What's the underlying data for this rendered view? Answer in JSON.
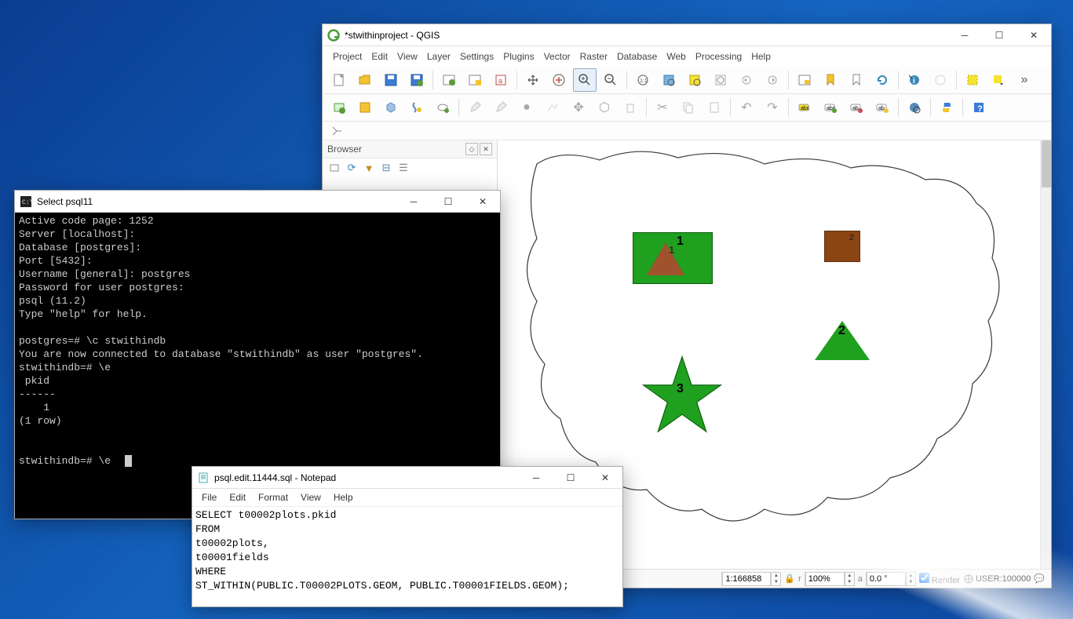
{
  "qgis": {
    "title": "*stwithinproject - QGIS",
    "menus": [
      "Project",
      "Edit",
      "View",
      "Layer",
      "Settings",
      "Plugins",
      "Vector",
      "Raster",
      "Database",
      "Web",
      "Processing",
      "Help"
    ],
    "browser_panel_title": "Browser",
    "status": {
      "scale_value": "1:166858",
      "mag_value": "100%",
      "rot_value": "0.0 °",
      "render_label": "Render",
      "user_label": "USER:100000"
    },
    "features": {
      "label1": "1",
      "label1b": "1",
      "label2": "2",
      "label2b": "2",
      "label3": "3"
    }
  },
  "terminal": {
    "title": "Select psql11",
    "lines": "Active code page: 1252\nServer [localhost]:\nDatabase [postgres]:\nPort [5432]:\nUsername [general]: postgres\nPassword for user postgres:\npsql (11.2)\nType \"help\" for help.\n\npostgres=# \\c stwithindb\nYou are now connected to database \"stwithindb\" as user \"postgres\".\nstwithindb=# \\e\n pkid\n------\n    1\n(1 row)\n\n\nstwithindb=# \\e"
  },
  "notepad": {
    "title": "psql.edit.11444.sql - Notepad",
    "menus": [
      "File",
      "Edit",
      "Format",
      "View",
      "Help"
    ],
    "content": "SELECT t00002plots.pkid\nFROM\nt00002plots,\nt00001fields\nWHERE\nST_WITHIN(PUBLIC.T00002PLOTS.GEOM, PUBLIC.T00001FIELDS.GEOM);"
  }
}
